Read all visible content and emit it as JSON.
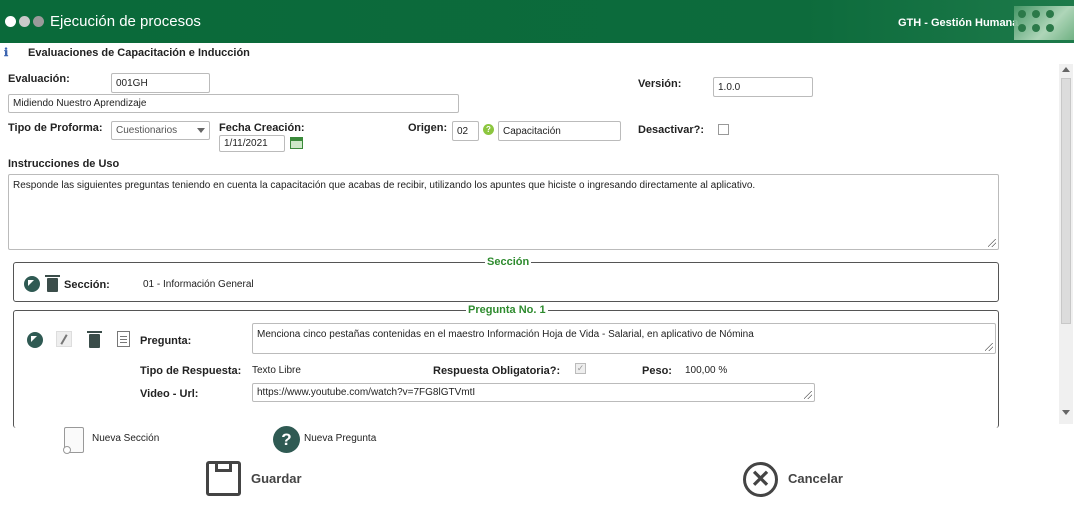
{
  "header": {
    "title": "Ejecución de procesos",
    "module": "GTH - Gestión Humana",
    "dot_colors": [
      "#ffffff",
      "#c9c9c9",
      "#9a9a9a"
    ]
  },
  "page": {
    "heading": "Evaluaciones de Capacitación e Inducción"
  },
  "form": {
    "evaluacion_label": "Evaluación:",
    "evaluacion_code": "001GH",
    "evaluacion_name": "Midiendo Nuestro Aprendizaje",
    "version_label": "Versión:",
    "version_value": "1.0.0",
    "tipo_proforma_label": "Tipo de Proforma:",
    "tipo_proforma_value": "Cuestionarios",
    "fecha_label": "Fecha Creación:",
    "fecha_value": "1/11/2021",
    "origen_label": "Origen:",
    "origen_code": "02",
    "origen_name": "Capacitación",
    "desactivar_label": "Desactivar?:",
    "instrucciones_label": "Instrucciones de Uso",
    "instrucciones_value": "Responde las siguientes preguntas teniendo en cuenta la capacitación que acabas de recibir, utilizando los apuntes que hiciste o ingresando directamente al aplicativo."
  },
  "seccion": {
    "legend": "Sección",
    "label": "Sección:",
    "value": "01 - Información General"
  },
  "pregunta": {
    "legend": "Pregunta No. 1",
    "pregunta_label": "Pregunta:",
    "pregunta_value": "Menciona cinco pestañas contenidas en el maestro Información Hoja de Vida - Salarial, en aplicativo de Nómina",
    "tipo_label": "Tipo de Respuesta:",
    "tipo_value": "Texto Libre",
    "obligatoria_label": "Respuesta Obligatoria?:",
    "obligatoria_checked": true,
    "peso_label": "Peso:",
    "peso_value": "100,00 %",
    "video_label": "Video - Url:",
    "video_value": "https://www.youtube.com/watch?v=7FG8lGTVmtI"
  },
  "actions": {
    "nueva_seccion": "Nueva Sección",
    "nueva_pregunta": "Nueva Pregunta",
    "guardar": "Guardar",
    "cancelar": "Cancelar"
  }
}
